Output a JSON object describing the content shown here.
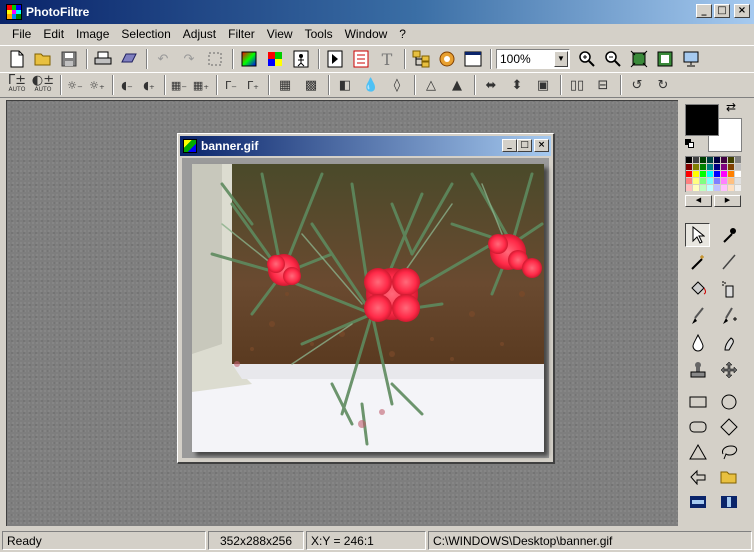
{
  "app": {
    "title": "PhotoFiltre",
    "window_buttons": {
      "minimize": "_",
      "maximize": "□",
      "close": "×"
    }
  },
  "menu": [
    "File",
    "Edit",
    "Image",
    "Selection",
    "Adjust",
    "Filter",
    "View",
    "Tools",
    "Window",
    "?"
  ],
  "toolbar": {
    "zoom_value": "100%",
    "text_tool_glyph": "T"
  },
  "child_window": {
    "title": "banner.gif",
    "buttons": {
      "minimize": "_",
      "maximize": "□",
      "close": "×"
    }
  },
  "status": {
    "state": "Ready",
    "dimensions": "352x288x256",
    "coords": "X:Y = 246:1",
    "path": "C:\\WINDOWS\\Desktop\\banner.gif"
  },
  "palette": {
    "foreground_color": "#000000",
    "background_color": "#ffffff",
    "swatches": [
      "#000000",
      "#404040",
      "#004000",
      "#004040",
      "#000040",
      "#400040",
      "#404000",
      "#808080",
      "#800000",
      "#808000",
      "#008000",
      "#008080",
      "#000080",
      "#800080",
      "#804000",
      "#c0c0c0",
      "#ff0000",
      "#ffff00",
      "#00ff00",
      "#00ffff",
      "#0000ff",
      "#ff00ff",
      "#ff8000",
      "#ffffff",
      "#ff8080",
      "#ffff80",
      "#80ff80",
      "#80ffff",
      "#8080ff",
      "#ff80ff",
      "#ffc080",
      "#e0e0e0",
      "#ffc0c0",
      "#ffffc0",
      "#c0ffc0",
      "#c0ffff",
      "#c0c0ff",
      "#ffc0ff",
      "#ffe0c0",
      "#f0f0f0"
    ]
  }
}
